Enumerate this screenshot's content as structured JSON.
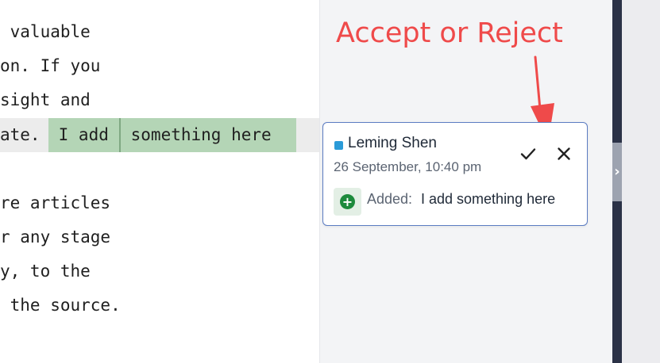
{
  "editor": {
    "lines": [
      " valuable",
      "on. If you",
      "sight and",
      "ate. ",
      "",
      "re articles",
      "r any stage",
      "y, to the",
      " the source."
    ],
    "tracked_insert": {
      "before_cursor": " I add",
      "after_cursor": " something here",
      "highlight_color": "#b4d5b6"
    }
  },
  "annotation": {
    "text": "Accept or Reject",
    "color": "#ef4a4a"
  },
  "review_panel": {
    "toggle_icon": "chevron-right-icon",
    "toggle_glyph": "›",
    "card": {
      "author": "Leming Shen",
      "author_color": "#2b9bd8",
      "timestamp": "26 September, 10:40 pm",
      "accept_icon": "check-icon",
      "reject_icon": "close-icon",
      "change_icon": "plus-circle-icon",
      "change_icon_glyph": "+",
      "change_label": "Added:",
      "change_text": "I add something here"
    }
  }
}
